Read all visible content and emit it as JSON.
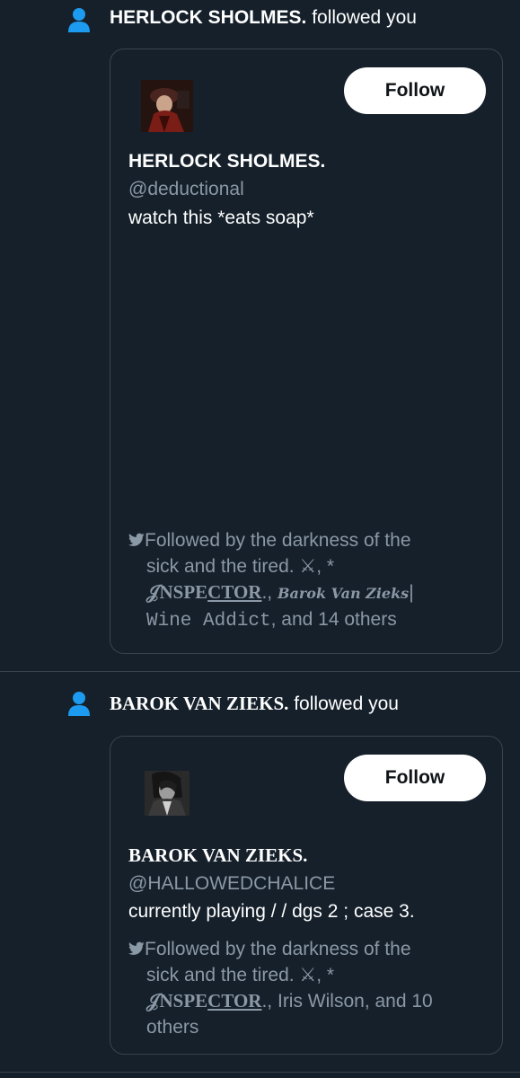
{
  "colors": {
    "background": "#15202b",
    "accent_blue": "#1d9bf0",
    "secondary_text": "#8b98a5",
    "border": "#38444d",
    "button_bg": "#ffffff"
  },
  "notifications": [
    {
      "header_name": "HERLOCK SHOLMES.",
      "header_action": "followed you",
      "icon": "person-icon",
      "card": {
        "name": "HERLOCK SHOLMES.",
        "handle": "@deductional",
        "bio": "watch this *eats soap*",
        "follow_label": "Follow",
        "followed_by": {
          "line1": "Followed by the darkness of the",
          "line2_a": "sick and the tired. ",
          "line2_x": "⚔,",
          "line2_star": "  *",
          "line3_inspector": "𝒥NSPE",
          "line3_ctor": "CTOR",
          "line3_sep": "., ",
          "line3_barok": "Barok Van Zieks",
          "line3_bar": "|",
          "line4_mono": "Wine Addict",
          "line4_rest": ", and 14 others"
        }
      }
    },
    {
      "header_name": "BAROK VAN ZIEKS.",
      "header_action": "followed you",
      "icon": "person-icon",
      "card": {
        "name": "BAROK VAN ZIEKS.",
        "handle": "@HALLOWEDCHALICE",
        "bio": "currently playing / / dgs 2 ; case 3.",
        "follow_label": "Follow",
        "followed_by": {
          "line1": "Followed by the darkness of the",
          "line2_a": "sick and the tired. ",
          "line2_x": "⚔,",
          "line2_star": "  *",
          "line3_inspector": "𝒥NSPE",
          "line3_ctor": "CTOR",
          "line3_sep": "., ",
          "line3_rest": "Iris Wilson, and 10",
          "line4_rest": "others"
        }
      }
    }
  ]
}
